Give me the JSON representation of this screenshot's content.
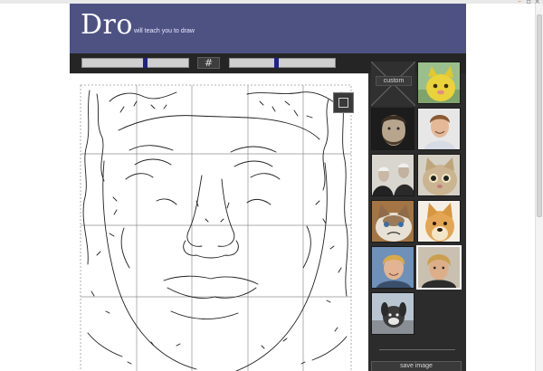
{
  "app": {
    "logo": "Dro",
    "tagline": "will teach you to draw"
  },
  "toolbar": {
    "grid_icon": "grid-icon",
    "slider_left_level": 0.6,
    "slider_right_level": 0.44
  },
  "sidebar": {
    "custom_label": "custom",
    "save_label": "save image",
    "thumbnails": [
      {
        "subject": "yellow-kitten",
        "selected": false
      },
      {
        "subject": "bearded-man-portrait",
        "selected": false
      },
      {
        "subject": "smiling-man-portrait",
        "selected": false
      },
      {
        "subject": "two-men-photo",
        "selected": false
      },
      {
        "subject": "wide-eyed-cat",
        "selected": false
      },
      {
        "subject": "grumpy-cat",
        "selected": false
      },
      {
        "subject": "doge-dog",
        "selected": false
      },
      {
        "subject": "blond-man-portrait",
        "selected": false
      },
      {
        "subject": "blond-man-portrait-2",
        "selected": true
      },
      {
        "subject": "puppy-photo",
        "selected": false
      }
    ]
  },
  "colors": {
    "header_bg": "#4d5283",
    "app_bg": "#2c2c2c",
    "slider_handle": "#212188"
  }
}
